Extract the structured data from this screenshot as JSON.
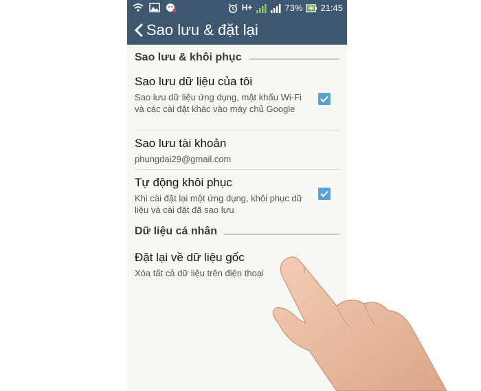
{
  "status_bar": {
    "battery_percent": "73%",
    "time": "21:45",
    "network_label": "H+"
  },
  "app_bar": {
    "title": "Sao lưu & đặt lại"
  },
  "sections": [
    {
      "header": "Sao lưu & khôi phục",
      "items": [
        {
          "title": "Sao lưu dữ liệu của tôi",
          "subtitle": "Sao lưu dữ liệu ứng dụng, mật khẩu Wi-Fi và các cài đặt khác vào máy chủ Google",
          "checked": true
        },
        {
          "title": "Sao lưu tài khoản",
          "subtitle": "phungdai29@gmail.com"
        },
        {
          "title": "Tự động khôi phục",
          "subtitle": "Khi cài đặt lại một ứng dụng, khôi phục dữ liệu và cài đặt đã sao lưu",
          "checked": true
        }
      ]
    },
    {
      "header": "Dữ liệu cá nhân",
      "items": [
        {
          "title": "Đặt lại về dữ liệu gốc",
          "subtitle": "Xóa tất cả dữ liệu trên điện thoại"
        }
      ]
    }
  ],
  "colors": {
    "app_bar": "#3f5872",
    "checkbox": "#5aa3d0",
    "background": "#f6f6f4"
  }
}
